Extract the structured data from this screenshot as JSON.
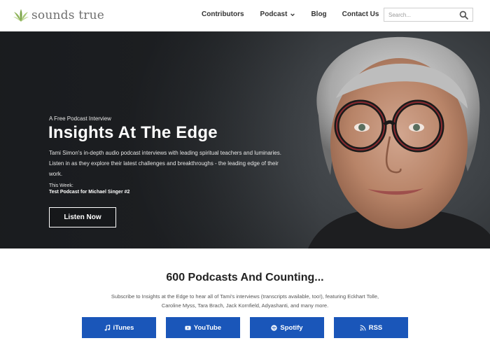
{
  "header": {
    "logo_text": "sounds true",
    "nav": {
      "contributors": "Contributors",
      "podcast": "Podcast",
      "blog": "Blog",
      "contact": "Contact Us"
    },
    "search_placeholder": "Search..."
  },
  "hero": {
    "eyebrow": "A Free Podcast Interview",
    "title": "Insights At The Edge",
    "description": "Tami Simon's in-depth audio podcast interviews with leading spiritual teachers and luminaries. Listen in as they explore their latest challenges and breakthroughs - the leading edge of their work.",
    "week_label": "This Week:",
    "week_title": "Test Podcast for Michael Singer #2",
    "cta": "Listen Now",
    "carousel_active_index": 2,
    "carousel_count": 3
  },
  "subscribe": {
    "title": "600 Podcasts And Counting...",
    "text": "Subscribe to Insights at the Edge to hear all of Tami's interviews (transcripts available, too!), featuring Eckhart Tolle, Caroline Myss, Tara Brach, Jack Kornfield, Adyashanti, and many more.",
    "buttons": [
      "iTunes",
      "YouTube",
      "Spotify",
      "RSS"
    ],
    "button_icons": [
      "music-note-icon",
      "youtube-icon",
      "spotify-icon",
      "rss-icon"
    ],
    "button_color": "#1a56b9"
  },
  "colors": {
    "logo_mark": "#8fb35a",
    "hero_bg": "#2a2d30"
  }
}
